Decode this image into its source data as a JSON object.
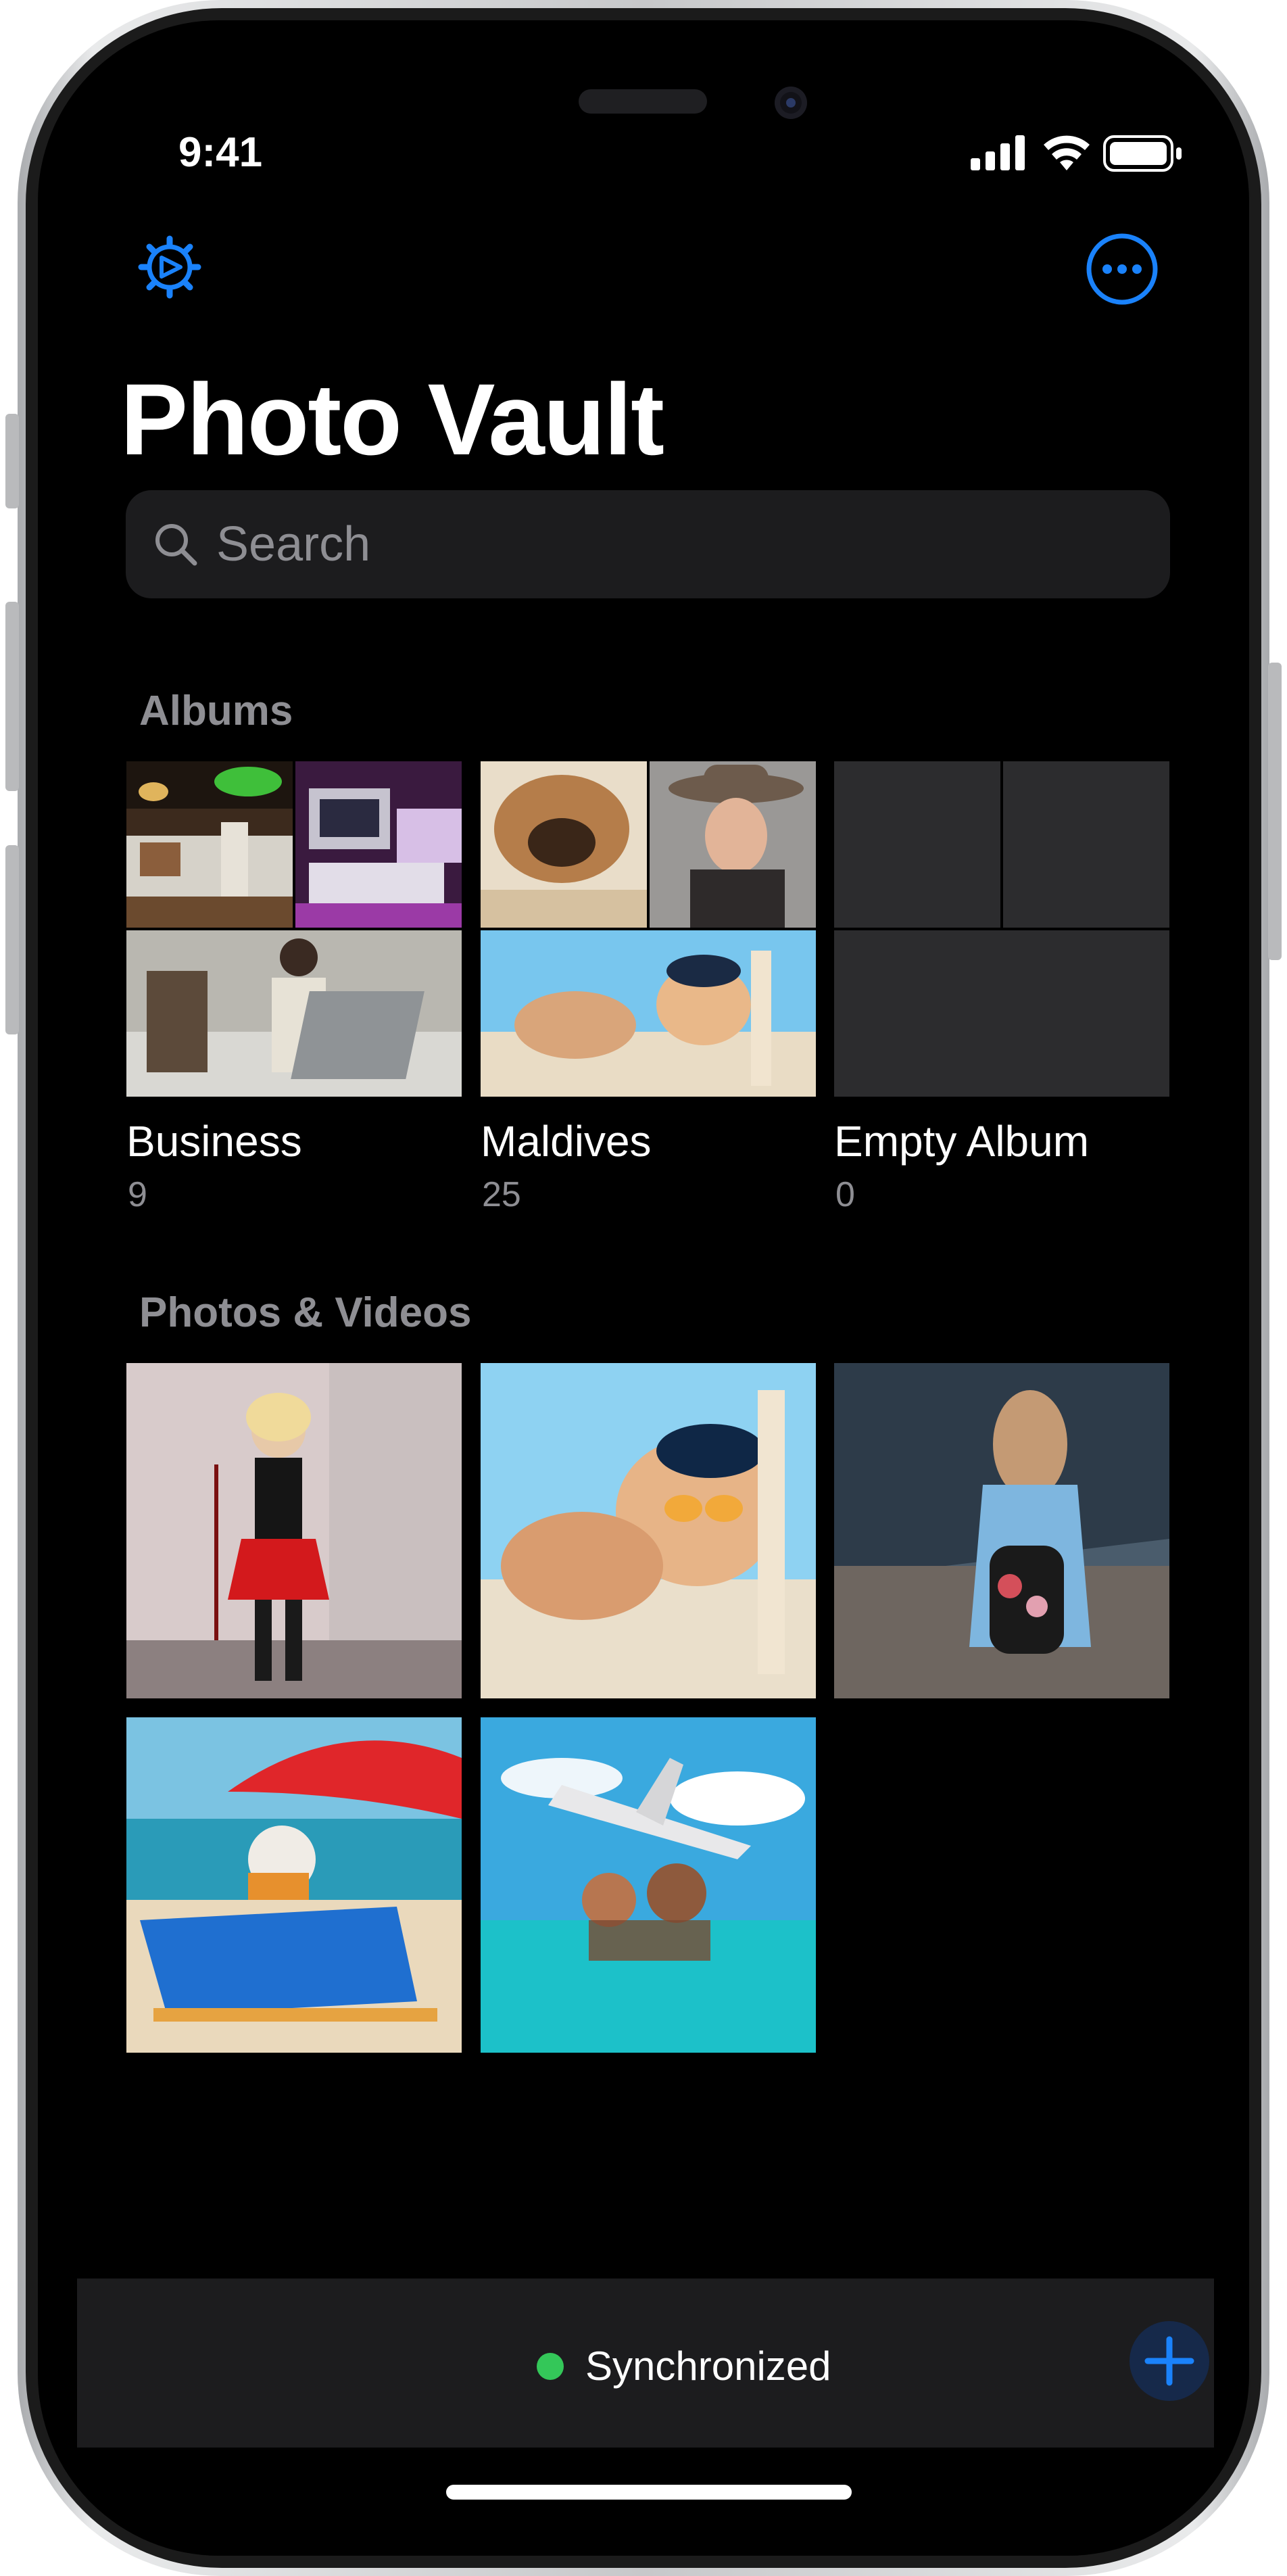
{
  "status_bar": {
    "time": "9:41"
  },
  "header": {
    "title": "Photo Vault",
    "settings_icon": "gear-play-icon",
    "more_icon": "ellipsis-circle-icon"
  },
  "search": {
    "placeholder": "Search",
    "value": ""
  },
  "albums_section": {
    "title": "Albums",
    "items": [
      {
        "name": "Business",
        "count": "9"
      },
      {
        "name": "Maldives",
        "count": "25"
      },
      {
        "name": "Empty Album",
        "count": "0"
      }
    ]
  },
  "photos_section": {
    "title": "Photos & Videos"
  },
  "footer": {
    "sync_status": "Synchronized",
    "add_icon": "plus-icon"
  },
  "colors": {
    "accent": "#1a82fb",
    "background": "#000000",
    "card": "#1c1c1e",
    "placeholder_tile": "#2c2c2e",
    "secondary_text": "#8e8e93",
    "sync_green": "#34c759"
  }
}
